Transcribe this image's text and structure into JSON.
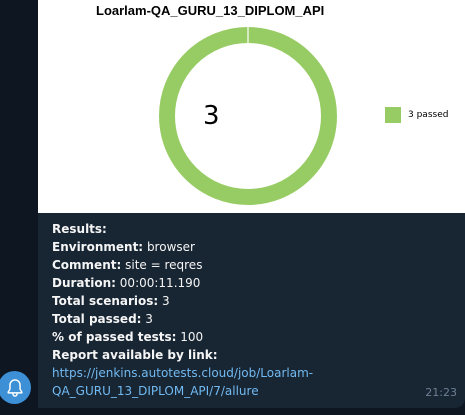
{
  "message": {
    "chart_image": {
      "title": "Loarlam-QA_GURU_13_DIPLOM_API",
      "center_value": "3",
      "legend_label": "3 passed",
      "color": "#97cc64",
      "chart_data": {
        "type": "pie",
        "title": "Loarlam-QA_GURU_13_DIPLOM_API",
        "series": [
          {
            "name": "3 passed",
            "values": [
              3
            ]
          }
        ]
      }
    },
    "caption": {
      "results_label": "Results:",
      "environment_label": "Environment:",
      "environment_value": "browser",
      "comment_label": "Comment:",
      "comment_value": "site = reqres",
      "duration_label": "Duration:",
      "duration_value": "00:00:11.190",
      "total_scenarios_label": "Total scenarios:",
      "total_scenarios_value": "3",
      "total_passed_label": "Total passed:",
      "total_passed_value": "3",
      "percent_label": "% of passed tests:",
      "percent_value": "100",
      "report_label": "Report available by link:",
      "link_line1": "https://jenkins.autotests.cloud/job/Loarlam-",
      "link_line2": "QA_GURU_13_DIPLOM_API/7/allure"
    },
    "time": "21:23"
  },
  "bell_icon": "bell-icon"
}
